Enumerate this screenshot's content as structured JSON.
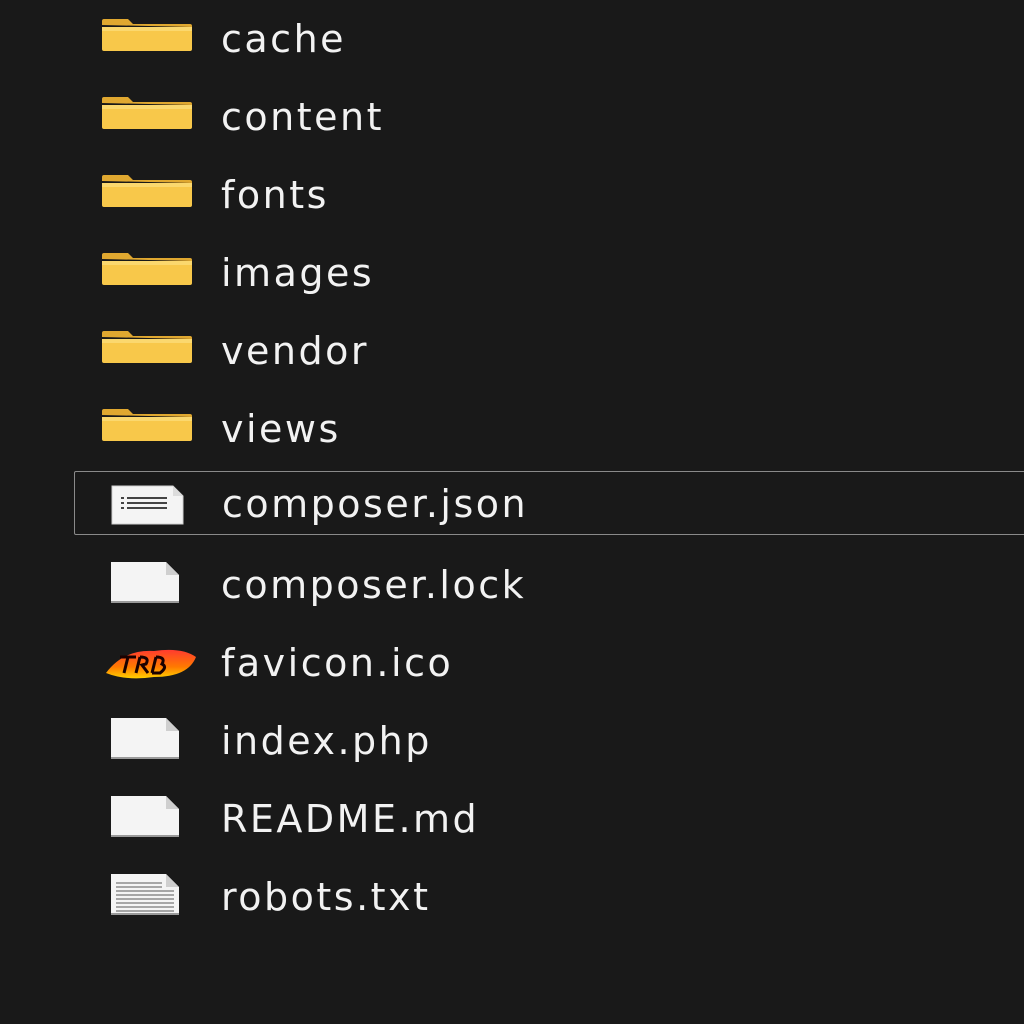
{
  "explorer": {
    "items": [
      {
        "label": "cache",
        "icon": "folder-icon"
      },
      {
        "label": "content",
        "icon": "folder-icon"
      },
      {
        "label": "fonts",
        "icon": "folder-icon"
      },
      {
        "label": "images",
        "icon": "folder-icon"
      },
      {
        "label": "vendor",
        "icon": "folder-icon"
      },
      {
        "label": "views",
        "icon": "folder-icon"
      },
      {
        "label": "composer.json",
        "icon": "json-file-icon",
        "focused": true
      },
      {
        "label": "composer.lock",
        "icon": "blank-file-icon"
      },
      {
        "label": "favicon.ico",
        "icon": "favicon-icon"
      },
      {
        "label": "index.php",
        "icon": "blank-file-icon"
      },
      {
        "label": "README.md",
        "icon": "blank-file-icon"
      },
      {
        "label": "robots.txt",
        "icon": "text-file-icon"
      }
    ]
  },
  "colors": {
    "background": "#191919",
    "text": "#f2f2f2",
    "folder": "#f8c84a",
    "focus_border": "#8a8a8a"
  }
}
